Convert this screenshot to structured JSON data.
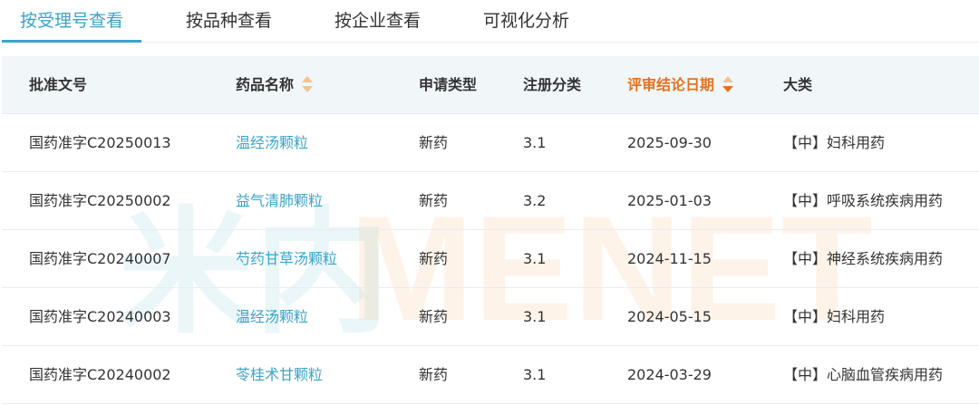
{
  "tabs": [
    {
      "label": "按受理号查看",
      "active": true
    },
    {
      "label": "按品种查看",
      "active": false
    },
    {
      "label": "按企业查看",
      "active": false
    },
    {
      "label": "可视化分析",
      "active": false
    }
  ],
  "table": {
    "headers": {
      "approval_no": "批准文号",
      "drug_name": "药品名称",
      "application_type": "申请类型",
      "registration_class": "注册分类",
      "review_date": "评审结论日期",
      "category": "大类"
    },
    "rows": [
      {
        "approval_no": "国药准字C20250013",
        "drug_name": "温经汤颗粒",
        "application_type": "新药",
        "registration_class": "3.1",
        "review_date": "2025-09-30",
        "category": "【中】妇科用药"
      },
      {
        "approval_no": "国药准字C20250002",
        "drug_name": "益气清肺颗粒",
        "application_type": "新药",
        "registration_class": "3.2",
        "review_date": "2025-01-03",
        "category": "【中】呼吸系统疾病用药"
      },
      {
        "approval_no": "国药准字C20240007",
        "drug_name": "芍药甘草汤颗粒",
        "application_type": "新药",
        "registration_class": "3.1",
        "review_date": "2024-11-15",
        "category": "【中】神经系统疾病用药"
      },
      {
        "approval_no": "国药准字C20240003",
        "drug_name": "温经汤颗粒",
        "application_type": "新药",
        "registration_class": "3.1",
        "review_date": "2024-05-15",
        "category": "【中】妇科用药"
      },
      {
        "approval_no": "国药准字C20240002",
        "drug_name": "苓桂术甘颗粒",
        "application_type": "新药",
        "registration_class": "3.1",
        "review_date": "2024-03-29",
        "category": "【中】心脑血管疾病用药"
      }
    ]
  },
  "watermark": {
    "left": "米内",
    "right": "MENET"
  },
  "colors": {
    "accent": "#3aa3c9",
    "sort_active": "#e8711f",
    "sort_inactive": "#f2c38f"
  }
}
